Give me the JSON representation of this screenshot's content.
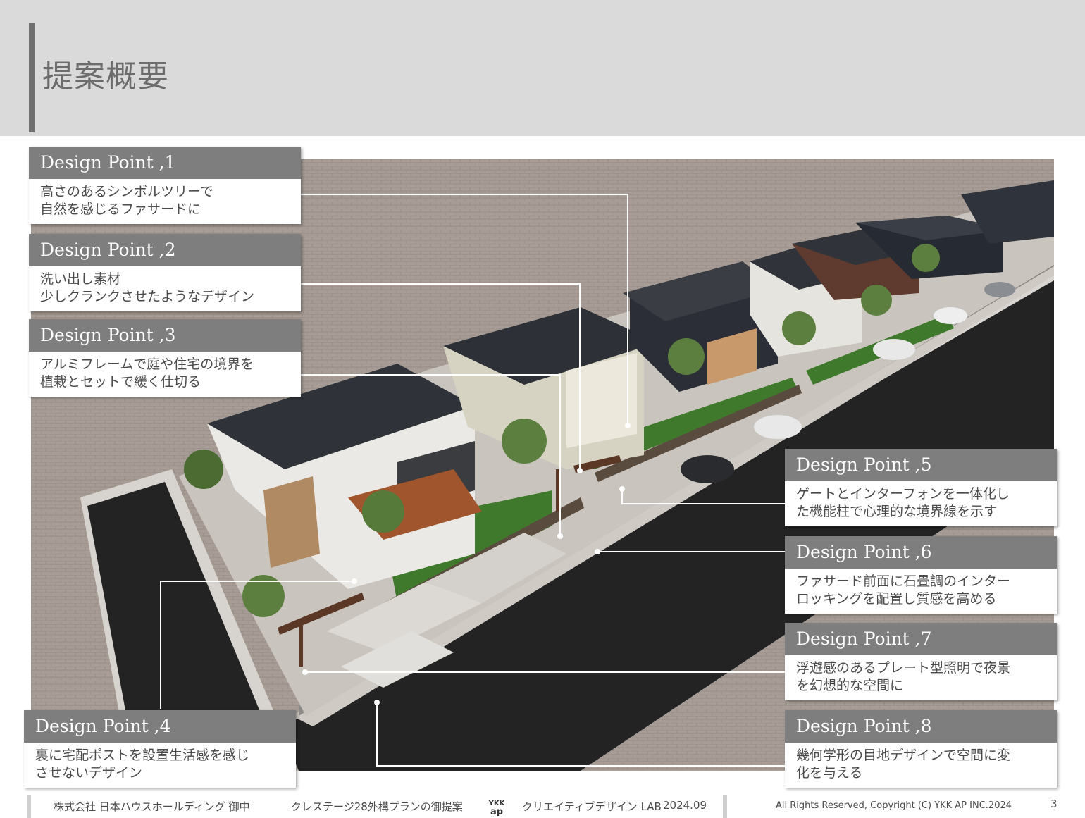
{
  "header": {
    "title": "提案概要"
  },
  "callouts": [
    {
      "title": "Design Point ,1",
      "lines": [
        "高さのあるシンボルツリーで",
        "自然を感じるファサードに"
      ]
    },
    {
      "title": "Design Point ,2",
      "lines": [
        "洗い出し素材",
        "少しクランクさせたようなデザイン"
      ]
    },
    {
      "title": "Design Point ,3",
      "lines": [
        "アルミフレームで庭や住宅の境界を",
        "植栽とセットで緩く仕切る"
      ]
    },
    {
      "title": "Design Point ,4",
      "lines": [
        "裏に宅配ポストを設置生活感を感じ",
        "させないデザイン"
      ]
    },
    {
      "title": "Design Point ,5",
      "lines": [
        "ゲートとインターフォンを一体化し",
        "た機能柱で心理的な境界線を示す"
      ]
    },
    {
      "title": "Design Point ,6",
      "lines": [
        "ファサード前面に石畳調のインター",
        "ロッキングを配置し質感を高める"
      ]
    },
    {
      "title": "Design Point ,7",
      "lines": [
        "浮遊感のあるプレート型照明で夜景",
        "を幻想的な空間に"
      ]
    },
    {
      "title": "Design Point ,8",
      "lines": [
        "幾何学形の目地デザインで空間に変",
        "化を与える"
      ]
    }
  ],
  "footer": {
    "client": "株式会社 日本ハウスホールディング 御中",
    "project": "クレステージ28外構プランの御提案",
    "logo_text": "YKK ap",
    "lab": "クリエイティブデザイン LAB",
    "date": "2024.09",
    "copyright": "All Rights Reserved, Copyright (C) YKK AP INC.2024",
    "page": "3"
  },
  "colors": {
    "header_bg": "#dadada",
    "callout_head": "#7e7e7e",
    "road": "#1f1f1f",
    "lawn": "#3f7a2c",
    "roof": "#33363d"
  }
}
